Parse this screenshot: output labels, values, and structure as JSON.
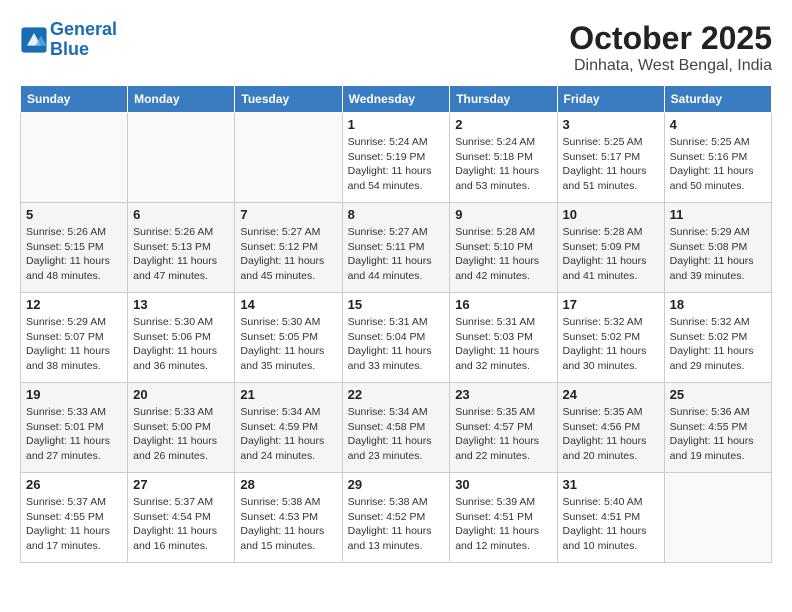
{
  "logo": {
    "line1": "General",
    "line2": "Blue"
  },
  "title": "October 2025",
  "subtitle": "Dinhata, West Bengal, India",
  "weekdays": [
    "Sunday",
    "Monday",
    "Tuesday",
    "Wednesday",
    "Thursday",
    "Friday",
    "Saturday"
  ],
  "weeks": [
    [
      {
        "day": "",
        "info": ""
      },
      {
        "day": "",
        "info": ""
      },
      {
        "day": "",
        "info": ""
      },
      {
        "day": "1",
        "info": "Sunrise: 5:24 AM\nSunset: 5:19 PM\nDaylight: 11 hours\nand 54 minutes."
      },
      {
        "day": "2",
        "info": "Sunrise: 5:24 AM\nSunset: 5:18 PM\nDaylight: 11 hours\nand 53 minutes."
      },
      {
        "day": "3",
        "info": "Sunrise: 5:25 AM\nSunset: 5:17 PM\nDaylight: 11 hours\nand 51 minutes."
      },
      {
        "day": "4",
        "info": "Sunrise: 5:25 AM\nSunset: 5:16 PM\nDaylight: 11 hours\nand 50 minutes."
      }
    ],
    [
      {
        "day": "5",
        "info": "Sunrise: 5:26 AM\nSunset: 5:15 PM\nDaylight: 11 hours\nand 48 minutes."
      },
      {
        "day": "6",
        "info": "Sunrise: 5:26 AM\nSunset: 5:13 PM\nDaylight: 11 hours\nand 47 minutes."
      },
      {
        "day": "7",
        "info": "Sunrise: 5:27 AM\nSunset: 5:12 PM\nDaylight: 11 hours\nand 45 minutes."
      },
      {
        "day": "8",
        "info": "Sunrise: 5:27 AM\nSunset: 5:11 PM\nDaylight: 11 hours\nand 44 minutes."
      },
      {
        "day": "9",
        "info": "Sunrise: 5:28 AM\nSunset: 5:10 PM\nDaylight: 11 hours\nand 42 minutes."
      },
      {
        "day": "10",
        "info": "Sunrise: 5:28 AM\nSunset: 5:09 PM\nDaylight: 11 hours\nand 41 minutes."
      },
      {
        "day": "11",
        "info": "Sunrise: 5:29 AM\nSunset: 5:08 PM\nDaylight: 11 hours\nand 39 minutes."
      }
    ],
    [
      {
        "day": "12",
        "info": "Sunrise: 5:29 AM\nSunset: 5:07 PM\nDaylight: 11 hours\nand 38 minutes."
      },
      {
        "day": "13",
        "info": "Sunrise: 5:30 AM\nSunset: 5:06 PM\nDaylight: 11 hours\nand 36 minutes."
      },
      {
        "day": "14",
        "info": "Sunrise: 5:30 AM\nSunset: 5:05 PM\nDaylight: 11 hours\nand 35 minutes."
      },
      {
        "day": "15",
        "info": "Sunrise: 5:31 AM\nSunset: 5:04 PM\nDaylight: 11 hours\nand 33 minutes."
      },
      {
        "day": "16",
        "info": "Sunrise: 5:31 AM\nSunset: 5:03 PM\nDaylight: 11 hours\nand 32 minutes."
      },
      {
        "day": "17",
        "info": "Sunrise: 5:32 AM\nSunset: 5:02 PM\nDaylight: 11 hours\nand 30 minutes."
      },
      {
        "day": "18",
        "info": "Sunrise: 5:32 AM\nSunset: 5:02 PM\nDaylight: 11 hours\nand 29 minutes."
      }
    ],
    [
      {
        "day": "19",
        "info": "Sunrise: 5:33 AM\nSunset: 5:01 PM\nDaylight: 11 hours\nand 27 minutes."
      },
      {
        "day": "20",
        "info": "Sunrise: 5:33 AM\nSunset: 5:00 PM\nDaylight: 11 hours\nand 26 minutes."
      },
      {
        "day": "21",
        "info": "Sunrise: 5:34 AM\nSunset: 4:59 PM\nDaylight: 11 hours\nand 24 minutes."
      },
      {
        "day": "22",
        "info": "Sunrise: 5:34 AM\nSunset: 4:58 PM\nDaylight: 11 hours\nand 23 minutes."
      },
      {
        "day": "23",
        "info": "Sunrise: 5:35 AM\nSunset: 4:57 PM\nDaylight: 11 hours\nand 22 minutes."
      },
      {
        "day": "24",
        "info": "Sunrise: 5:35 AM\nSunset: 4:56 PM\nDaylight: 11 hours\nand 20 minutes."
      },
      {
        "day": "25",
        "info": "Sunrise: 5:36 AM\nSunset: 4:55 PM\nDaylight: 11 hours\nand 19 minutes."
      }
    ],
    [
      {
        "day": "26",
        "info": "Sunrise: 5:37 AM\nSunset: 4:55 PM\nDaylight: 11 hours\nand 17 minutes."
      },
      {
        "day": "27",
        "info": "Sunrise: 5:37 AM\nSunset: 4:54 PM\nDaylight: 11 hours\nand 16 minutes."
      },
      {
        "day": "28",
        "info": "Sunrise: 5:38 AM\nSunset: 4:53 PM\nDaylight: 11 hours\nand 15 minutes."
      },
      {
        "day": "29",
        "info": "Sunrise: 5:38 AM\nSunset: 4:52 PM\nDaylight: 11 hours\nand 13 minutes."
      },
      {
        "day": "30",
        "info": "Sunrise: 5:39 AM\nSunset: 4:51 PM\nDaylight: 11 hours\nand 12 minutes."
      },
      {
        "day": "31",
        "info": "Sunrise: 5:40 AM\nSunset: 4:51 PM\nDaylight: 11 hours\nand 10 minutes."
      },
      {
        "day": "",
        "info": ""
      }
    ]
  ]
}
